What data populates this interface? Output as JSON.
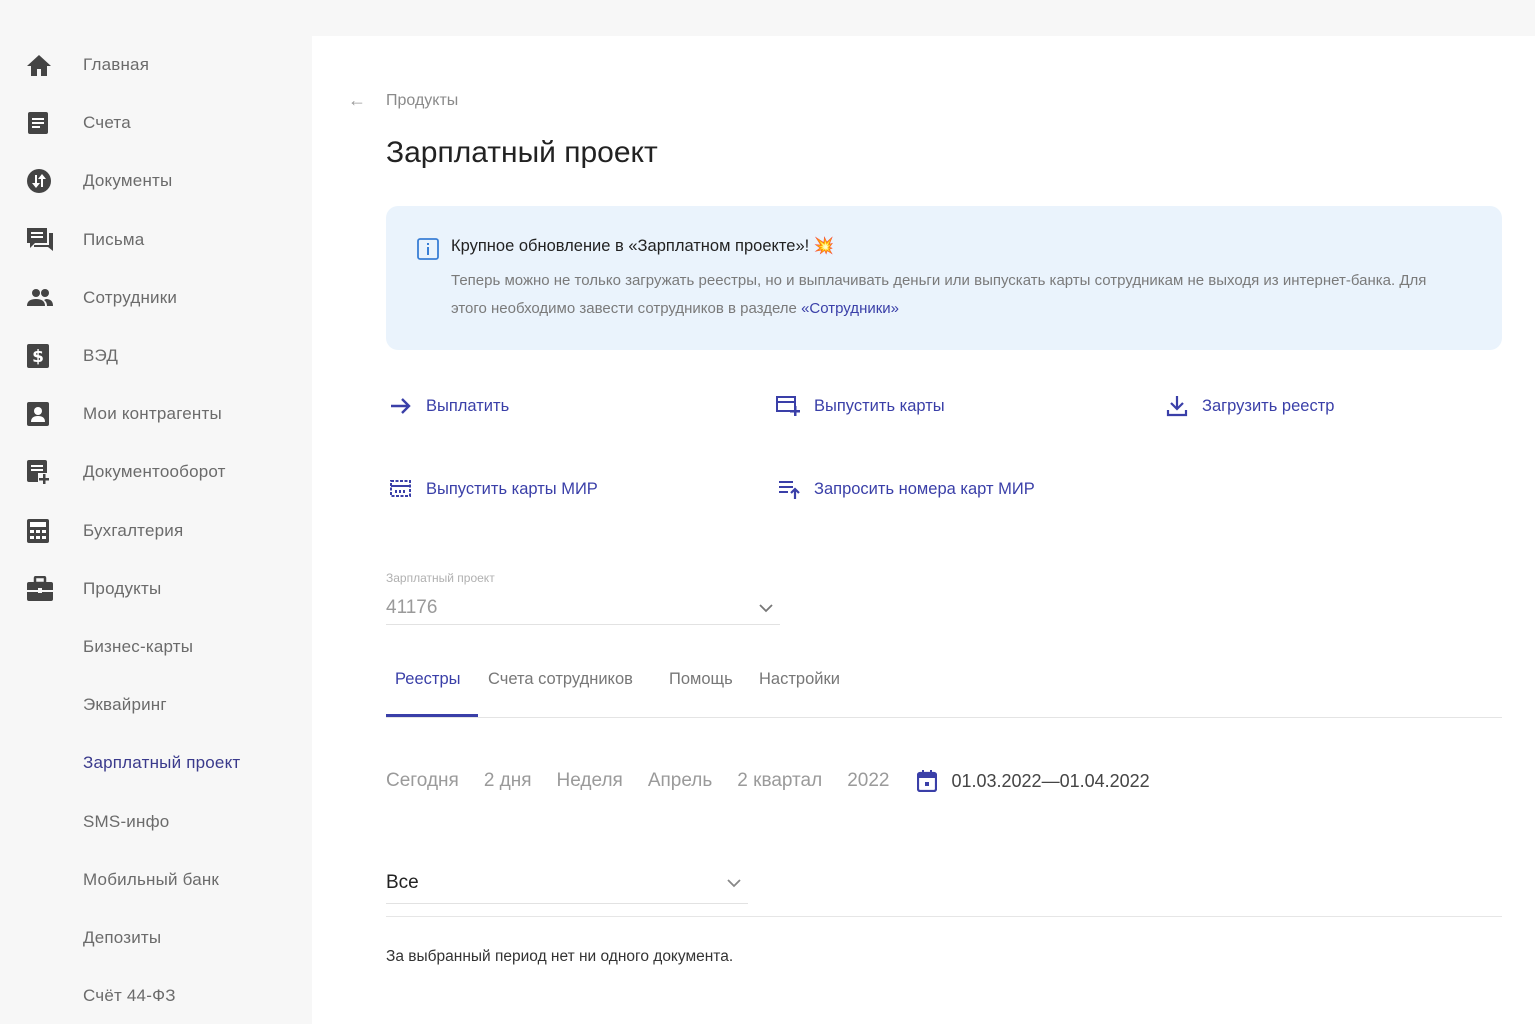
{
  "sidebar": {
    "items": [
      {
        "label": "Главная",
        "icon": "home-icon"
      },
      {
        "label": "Счета",
        "icon": "document-list-icon"
      },
      {
        "label": "Документы",
        "icon": "exchange-circle-icon"
      },
      {
        "label": "Письма",
        "icon": "chat-icon"
      },
      {
        "label": "Сотрудники",
        "icon": "people-icon"
      },
      {
        "label": "ВЭД",
        "icon": "dollar-icon"
      },
      {
        "label": "Мои контрагенты",
        "icon": "contact-card-icon"
      },
      {
        "label": "Документооборот",
        "icon": "document-add-icon"
      },
      {
        "label": "Бухгалтерия",
        "icon": "calculator-icon"
      },
      {
        "label": "Продукты",
        "icon": "briefcase-icon"
      }
    ],
    "subitems": [
      {
        "label": "Бизнес-карты"
      },
      {
        "label": "Эквайринг"
      },
      {
        "label": "Зарплатный проект"
      },
      {
        "label": "SMS-инфо"
      },
      {
        "label": "Мобильный банк"
      },
      {
        "label": "Депозиты"
      },
      {
        "label": "Счёт 44-ФЗ"
      }
    ]
  },
  "breadcrumb": {
    "label": "Продукты"
  },
  "page_title": "Зарплатный проект",
  "notice": {
    "title": "Крупное обновление в «Зарплатном проекте»! 💥",
    "body": "Теперь можно не только загружать реестры, но и выплачивать деньги или выпускать карты сотрудникам не выходя из интернет-банка. Для этого необходимо завести сотрудников в разделе ",
    "link": "«Сотрудники»"
  },
  "actions": {
    "pay": "Выплатить",
    "issue_cards": "Выпустить карты",
    "upload_registry": "Загрузить реестр",
    "issue_mir": "Выпустить карты МИР",
    "request_mir": "Запросить номера карт МИР"
  },
  "project_select": {
    "label": "Зарплатный проект",
    "value": "41176"
  },
  "tabs": [
    "Реестры",
    "Счета сотрудников",
    "Помощь",
    "Настройки"
  ],
  "periods": [
    "Сегодня",
    "2 дня",
    "Неделя",
    "Апрель",
    "2 квартал",
    "2022"
  ],
  "date_range": {
    "from": "01.03.2022",
    "to": "01.04.2022",
    "separator": "—"
  },
  "filter": {
    "value": "Все"
  },
  "empty_message": "За выбранный период нет ни одного документа.",
  "colors": {
    "accent": "#3a3fa8",
    "notice_bg": "#eaf3fc",
    "sidebar_bg": "#f7f7f7"
  }
}
